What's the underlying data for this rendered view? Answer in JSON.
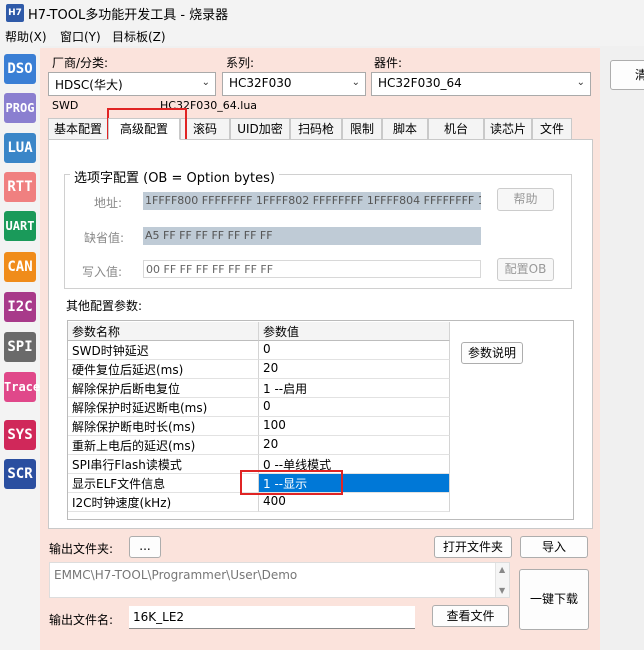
{
  "app": {
    "icon_label": "H7",
    "title": "H7-TOOL多功能开发工具 - 烧录器"
  },
  "menu": [
    "帮助(X)",
    "窗口(Y)",
    "目标板(Z)"
  ],
  "left_toolbar": [
    {
      "label": "DSO",
      "color": "#3a7fd5"
    },
    {
      "label": "PROG",
      "color": "#8a7fd0"
    },
    {
      "label": "LUA",
      "color": "#3a86c8"
    },
    {
      "label": "RTT",
      "color": "#f08080"
    },
    {
      "label": "UART",
      "color": "#1a9a5a"
    },
    {
      "label": "CAN",
      "color": "#f08c1a"
    },
    {
      "label": "I2C",
      "color": "#a83a8a"
    },
    {
      "label": "SPI",
      "color": "#6a6a6a"
    },
    {
      "label": "Trace",
      "color": "#e0488a"
    },
    {
      "label": "SYS",
      "color": "#d0285a"
    },
    {
      "label": "SCR",
      "color": "#2a4fa0"
    }
  ],
  "selectors": {
    "vendor_label": "厂商/分类:",
    "vendor_value": "HDSC(华大)",
    "series_label": "系列:",
    "series_value": "HC32F030",
    "device_label": "器件:",
    "device_value": "HC32F030_64"
  },
  "info": {
    "interface": "SWD",
    "lua_file": "HC32F030_64.lua"
  },
  "tabs": [
    "基本配置",
    "高级配置",
    "滚码",
    "UID加密",
    "扫码枪",
    "限制",
    "脚本",
    "机台",
    "读芯片",
    "文件"
  ],
  "option_bytes": {
    "title": "选项字配置 (OB = Option bytes)",
    "address_label": "地址:",
    "address_value": "1FFFF800 FFFFFFFF  1FFFF802 FFFFFFFF  1FFFF804 FFFFFFFF  1FFFF",
    "default_label": "缺省值:",
    "default_value": "A5 FF FF FF FF FF FF FF",
    "write_label": "写入值:",
    "write_value": "00 FF FF FF FF FF FF FF",
    "help_button": "帮助",
    "config_button": "配置OB"
  },
  "params": {
    "title": "其他配置参数:",
    "col_name": "参数名称",
    "col_value": "参数值",
    "explain_button": "参数说明",
    "rows": [
      {
        "name": "SWD时钟延迟",
        "value": "0"
      },
      {
        "name": "硬件复位后延迟(ms)",
        "value": "20"
      },
      {
        "name": "解除保护后断电复位",
        "value": "1 --启用"
      },
      {
        "name": "解除保护时延迟断电(ms)",
        "value": "0"
      },
      {
        "name": "解除保护断电时长(ms)",
        "value": "100"
      },
      {
        "name": "重新上电后的延迟(ms)",
        "value": "20"
      },
      {
        "name": "SPI串行Flash读模式",
        "value": "0 --单线模式"
      },
      {
        "name": "显示ELF文件信息",
        "value": "1 --显示"
      },
      {
        "name": "I2C时钟速度(kHz)",
        "value": "400"
      }
    ]
  },
  "output": {
    "folder_label": "输出文件夹:",
    "browse_button": "...",
    "open_folder_button": "打开文件夹",
    "import_button": "导入",
    "path": "EMMC\\H7-TOOL\\Programmer\\User\\Demo",
    "file_label": "输出文件名:",
    "file_value": "16K_LE2",
    "view_file_button": "查看文件",
    "download_button": "一键下载"
  },
  "right_partial_button": "清"
}
